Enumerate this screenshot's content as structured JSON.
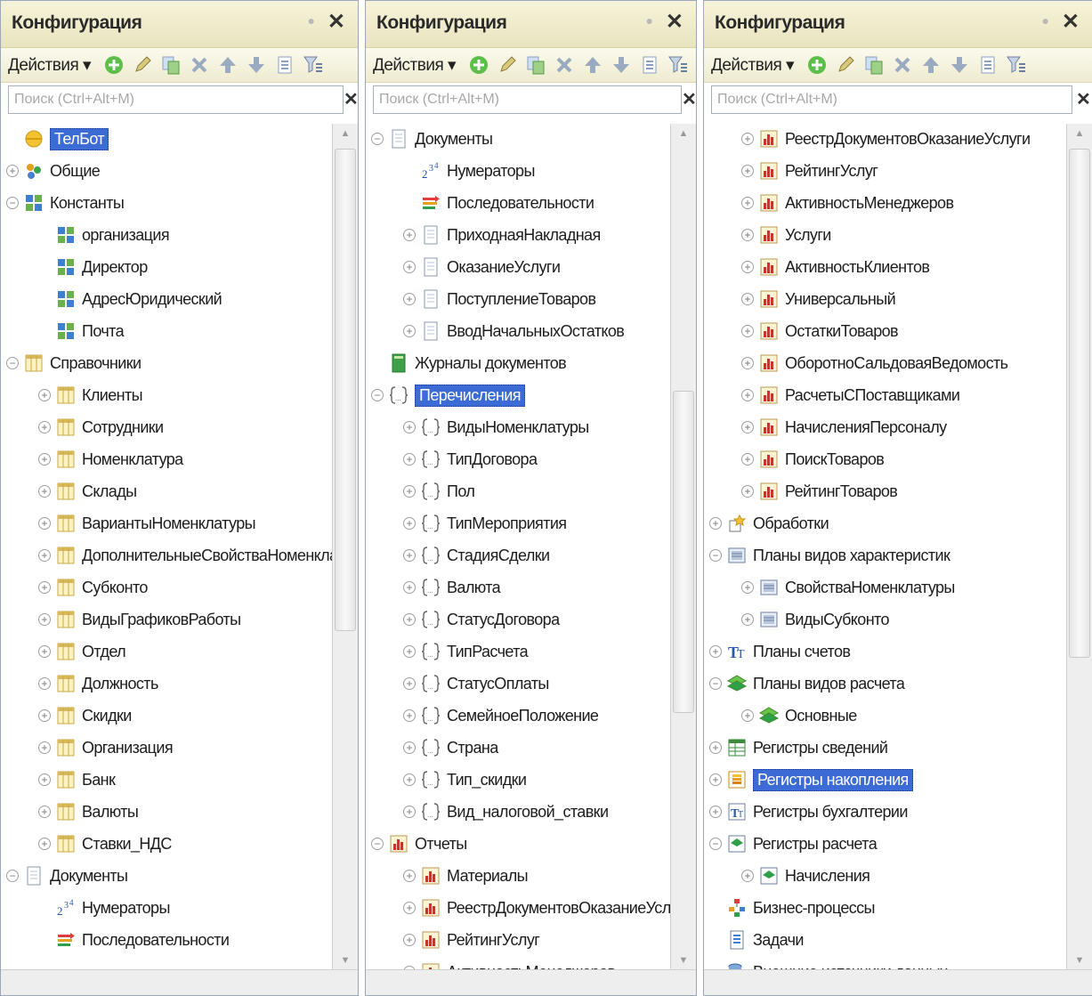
{
  "panel1": {
    "title": "Конфигурация",
    "actions": "Действия ▾",
    "search_placeholder": "Поиск (Ctrl+Alt+M)",
    "items": [
      {
        "label": "ТелБот",
        "icon": "root",
        "exp": "",
        "level": 0,
        "selected": true
      },
      {
        "label": "Общие",
        "icon": "general",
        "exp": "+",
        "level": 0
      },
      {
        "label": "Константы",
        "icon": "const",
        "exp": "−",
        "level": 0
      },
      {
        "label": "организация",
        "icon": "const",
        "exp": "",
        "level": 1
      },
      {
        "label": "Директор",
        "icon": "const",
        "exp": "",
        "level": 1
      },
      {
        "label": "АдресЮридический",
        "icon": "const",
        "exp": "",
        "level": 1
      },
      {
        "label": "Почта",
        "icon": "const",
        "exp": "",
        "level": 1
      },
      {
        "label": "Справочники",
        "icon": "catalog",
        "exp": "−",
        "level": 0
      },
      {
        "label": "Клиенты",
        "icon": "catalog",
        "exp": "+",
        "level": 1
      },
      {
        "label": "Сотрудники",
        "icon": "catalog",
        "exp": "+",
        "level": 1
      },
      {
        "label": "Номенклатура",
        "icon": "catalog",
        "exp": "+",
        "level": 1
      },
      {
        "label": "Склады",
        "icon": "catalog",
        "exp": "+",
        "level": 1
      },
      {
        "label": "ВариантыНоменклатуры",
        "icon": "catalog",
        "exp": "+",
        "level": 1
      },
      {
        "label": "ДополнительныеСвойстваНоменклат",
        "icon": "catalog",
        "exp": "+",
        "level": 1
      },
      {
        "label": "Субконто",
        "icon": "catalog",
        "exp": "+",
        "level": 1
      },
      {
        "label": "ВидыГрафиковРаботы",
        "icon": "catalog",
        "exp": "+",
        "level": 1
      },
      {
        "label": "Отдел",
        "icon": "catalog",
        "exp": "+",
        "level": 1
      },
      {
        "label": "Должность",
        "icon": "catalog",
        "exp": "+",
        "level": 1
      },
      {
        "label": "Скидки",
        "icon": "catalog",
        "exp": "+",
        "level": 1
      },
      {
        "label": "Организация",
        "icon": "catalog",
        "exp": "+",
        "level": 1
      },
      {
        "label": "Банк",
        "icon": "catalog",
        "exp": "+",
        "level": 1
      },
      {
        "label": "Валюты",
        "icon": "catalog",
        "exp": "+",
        "level": 1
      },
      {
        "label": "Ставки_НДС",
        "icon": "catalog",
        "exp": "+",
        "level": 1
      },
      {
        "label": "Документы",
        "icon": "doc",
        "exp": "−",
        "level": 0
      },
      {
        "label": "Нумераторы",
        "icon": "numerator",
        "exp": "",
        "level": 1
      },
      {
        "label": "Последовательности",
        "icon": "sequence",
        "exp": "",
        "level": 1
      }
    ]
  },
  "panel2": {
    "title": "Конфигурация",
    "actions": "Действия ▾",
    "search_placeholder": "Поиск (Ctrl+Alt+M)",
    "items": [
      {
        "label": "Документы",
        "icon": "doc",
        "exp": "−",
        "level": 0
      },
      {
        "label": "Нумераторы",
        "icon": "numerator",
        "exp": "",
        "level": 1
      },
      {
        "label": "Последовательности",
        "icon": "sequence",
        "exp": "",
        "level": 1
      },
      {
        "label": "ПриходнаяНакладная",
        "icon": "doc",
        "exp": "+",
        "level": 1
      },
      {
        "label": "ОказаниеУслуги",
        "icon": "doc",
        "exp": "+",
        "level": 1
      },
      {
        "label": "ПоступлениеТоваров",
        "icon": "doc",
        "exp": "+",
        "level": 1
      },
      {
        "label": "ВводНачальныхОстатков",
        "icon": "doc",
        "exp": "+",
        "level": 1
      },
      {
        "label": "Журналы документов",
        "icon": "journal",
        "exp": "",
        "level": 0
      },
      {
        "label": "Перечисления",
        "icon": "enum",
        "exp": "−",
        "level": 0,
        "selected": true
      },
      {
        "label": "ВидыНоменклатуры",
        "icon": "enum",
        "exp": "+",
        "level": 1
      },
      {
        "label": "ТипДоговора",
        "icon": "enum",
        "exp": "+",
        "level": 1
      },
      {
        "label": "Пол",
        "icon": "enum",
        "exp": "+",
        "level": 1
      },
      {
        "label": "ТипМероприятия",
        "icon": "enum",
        "exp": "+",
        "level": 1
      },
      {
        "label": "СтадияСделки",
        "icon": "enum",
        "exp": "+",
        "level": 1
      },
      {
        "label": "Валюта",
        "icon": "enum",
        "exp": "+",
        "level": 1
      },
      {
        "label": "СтатусДоговора",
        "icon": "enum",
        "exp": "+",
        "level": 1
      },
      {
        "label": "ТипРасчета",
        "icon": "enum",
        "exp": "+",
        "level": 1
      },
      {
        "label": "СтатусОплаты",
        "icon": "enum",
        "exp": "+",
        "level": 1
      },
      {
        "label": "СемейноеПоложение",
        "icon": "enum",
        "exp": "+",
        "level": 1
      },
      {
        "label": "Страна",
        "icon": "enum",
        "exp": "+",
        "level": 1
      },
      {
        "label": "Тип_скидки",
        "icon": "enum",
        "exp": "+",
        "level": 1
      },
      {
        "label": "Вид_налоговой_ставки",
        "icon": "enum",
        "exp": "+",
        "level": 1
      },
      {
        "label": "Отчеты",
        "icon": "report",
        "exp": "−",
        "level": 0
      },
      {
        "label": "Материалы",
        "icon": "report",
        "exp": "+",
        "level": 1
      },
      {
        "label": "РеестрДокументовОказаниеУслуги",
        "icon": "report",
        "exp": "+",
        "level": 1
      },
      {
        "label": "РейтингУслуг",
        "icon": "report",
        "exp": "+",
        "level": 1
      },
      {
        "label": "АктивностьМенеджеров",
        "icon": "report",
        "exp": "+",
        "level": 1
      }
    ]
  },
  "panel3": {
    "title": "Конфигурация",
    "actions": "Действия ▾",
    "search_placeholder": "Поиск (Ctrl+Alt+M)",
    "items": [
      {
        "label": "РеестрДокументовОказаниеУслуги",
        "icon": "report",
        "exp": "+",
        "level": 1
      },
      {
        "label": "РейтингУслуг",
        "icon": "report",
        "exp": "+",
        "level": 1
      },
      {
        "label": "АктивностьМенеджеров",
        "icon": "report",
        "exp": "+",
        "level": 1
      },
      {
        "label": "Услуги",
        "icon": "report",
        "exp": "+",
        "level": 1
      },
      {
        "label": "АктивностьКлиентов",
        "icon": "report",
        "exp": "+",
        "level": 1
      },
      {
        "label": "Универсальный",
        "icon": "report",
        "exp": "+",
        "level": 1
      },
      {
        "label": "ОстаткиТоваров",
        "icon": "report",
        "exp": "+",
        "level": 1
      },
      {
        "label": "ОборотноСальдоваяВедомость",
        "icon": "report",
        "exp": "+",
        "level": 1
      },
      {
        "label": "РасчетыСПоставщиками",
        "icon": "report",
        "exp": "+",
        "level": 1
      },
      {
        "label": "НачисленияПерсоналу",
        "icon": "report",
        "exp": "+",
        "level": 1
      },
      {
        "label": "ПоискТоваров",
        "icon": "report",
        "exp": "+",
        "level": 1
      },
      {
        "label": "РейтингТоваров",
        "icon": "report",
        "exp": "+",
        "level": 1
      },
      {
        "label": "Обработки",
        "icon": "dataproc",
        "exp": "+",
        "level": 0
      },
      {
        "label": "Планы видов характеристик",
        "icon": "chartchar",
        "exp": "−",
        "level": 0
      },
      {
        "label": "СвойстваНоменклатуры",
        "icon": "chartchar",
        "exp": "+",
        "level": 1
      },
      {
        "label": "ВидыСубконто",
        "icon": "chartchar",
        "exp": "+",
        "level": 1
      },
      {
        "label": "Планы счетов",
        "icon": "accounts",
        "exp": "+",
        "level": 0
      },
      {
        "label": "Планы видов расчета",
        "icon": "calc",
        "exp": "−",
        "level": 0
      },
      {
        "label": "Основные",
        "icon": "calc",
        "exp": "+",
        "level": 1
      },
      {
        "label": "Регистры сведений",
        "icon": "inforeg",
        "exp": "+",
        "level": 0
      },
      {
        "label": "Регистры накопления",
        "icon": "accumreg",
        "exp": "+",
        "level": 0,
        "selected": true
      },
      {
        "label": "Регистры бухгалтерии",
        "icon": "acctreg",
        "exp": "+",
        "level": 0
      },
      {
        "label": "Регистры расчета",
        "icon": "calcreg",
        "exp": "−",
        "level": 0
      },
      {
        "label": "Начисления",
        "icon": "calcreg",
        "exp": "+",
        "level": 1
      },
      {
        "label": "Бизнес-процессы",
        "icon": "bizproc",
        "exp": "",
        "level": 0
      },
      {
        "label": "Задачи",
        "icon": "task",
        "exp": "",
        "level": 0
      },
      {
        "label": "Внешние источники данных",
        "icon": "extsrc",
        "exp": "",
        "level": 0
      }
    ]
  },
  "colors": {
    "selection": "#3d6bd6",
    "title_bg": "#f2eed0",
    "accent_green": "#35a63a",
    "report_red": "#c0392b"
  }
}
